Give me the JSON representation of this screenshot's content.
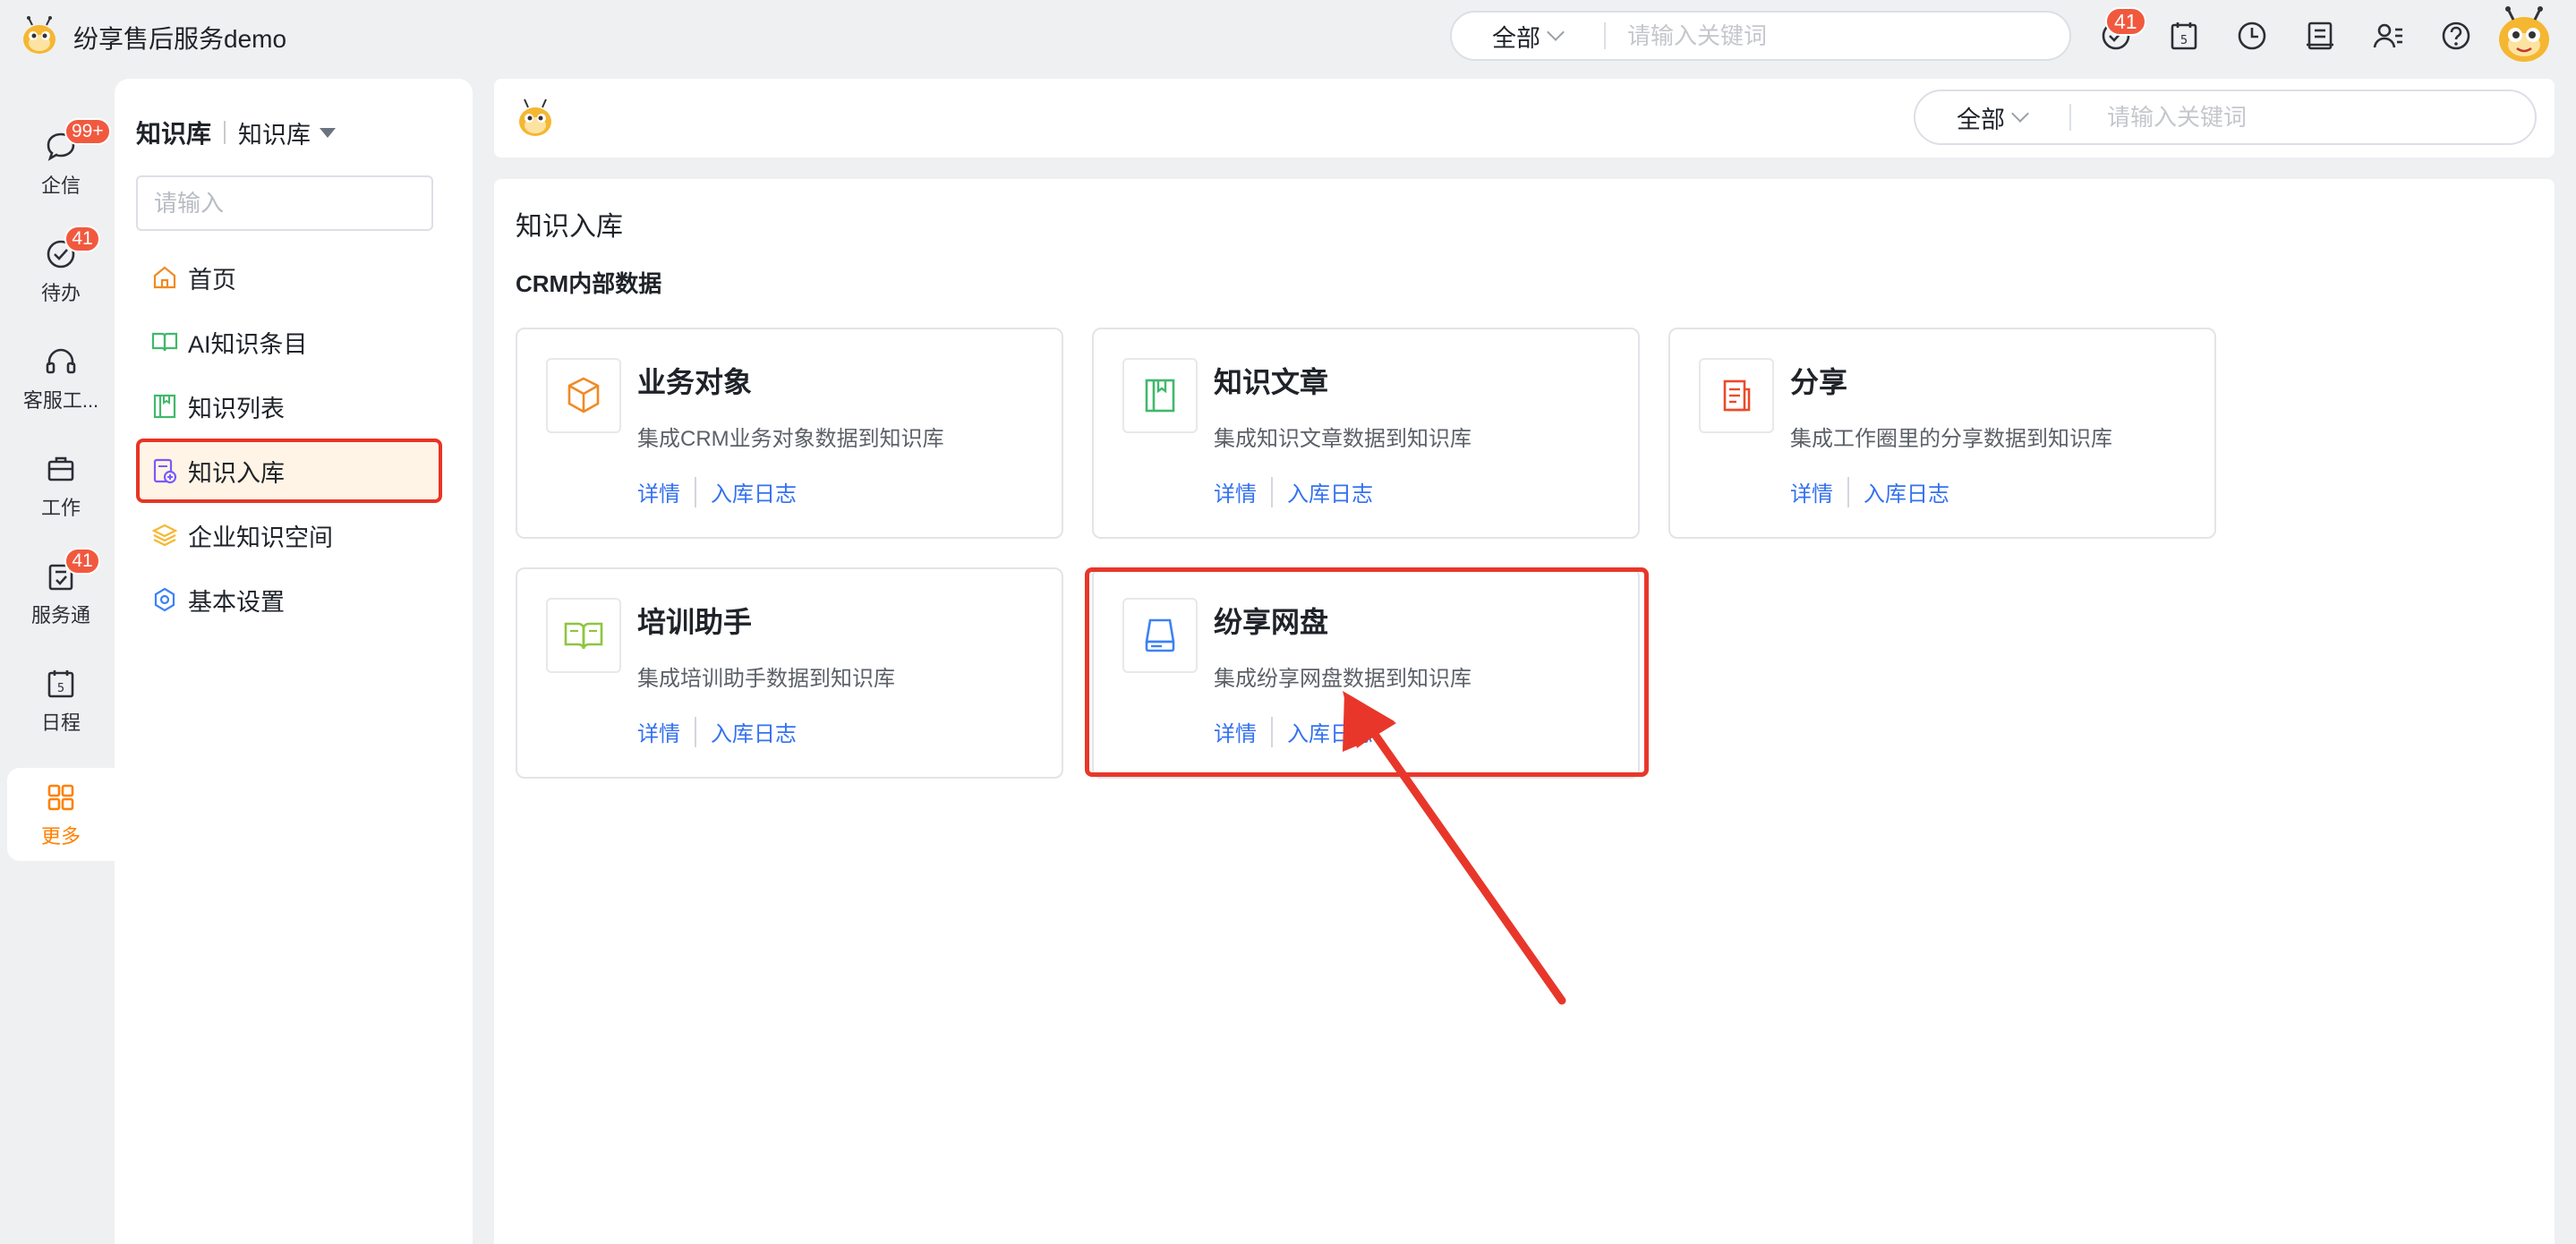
{
  "app": {
    "title": "纷享售后服务demo"
  },
  "topbar": {
    "search_scope": "全部",
    "search_placeholder": "请输入关键词",
    "notification_badge": "41",
    "icons": [
      "approval-icon",
      "calendar-icon",
      "clock-icon",
      "report-icon",
      "contacts-icon",
      "help-icon"
    ]
  },
  "rail": {
    "items": [
      {
        "label": "企信",
        "icon": "chat-icon",
        "badge": "99+"
      },
      {
        "label": "待办",
        "icon": "todo-icon",
        "badge": "41"
      },
      {
        "label": "客服工...",
        "icon": "headset-icon"
      },
      {
        "label": "工作",
        "icon": "briefcase-icon"
      },
      {
        "label": "服务通",
        "icon": "service-icon",
        "badge": "41"
      },
      {
        "label": "日程",
        "icon": "calendar-icon"
      },
      {
        "label": "更多",
        "icon": "grid-icon"
      }
    ]
  },
  "sidebar": {
    "title": "知识库",
    "subtitle": "知识库",
    "search_placeholder": "请输入",
    "menu": [
      {
        "label": "首页",
        "icon": "home-icon"
      },
      {
        "label": "AI知识条目",
        "icon": "book-icon"
      },
      {
        "label": "知识列表",
        "icon": "list-icon"
      },
      {
        "label": "知识入库",
        "icon": "import-icon",
        "active": true
      },
      {
        "label": "企业知识空间",
        "icon": "layers-icon"
      },
      {
        "label": "基本设置",
        "icon": "settings-icon"
      }
    ]
  },
  "mainhead": {
    "search_scope": "全部",
    "search_placeholder": "请输入关键词"
  },
  "content": {
    "page_title": "知识入库",
    "section_title": "CRM内部数据",
    "cards": [
      {
        "name": "业务对象",
        "desc": "集成CRM业务对象数据到知识库",
        "detail": "详情",
        "log": "入库日志",
        "icon": "cube-icon",
        "color": "#f08a24"
      },
      {
        "name": "知识文章",
        "desc": "集成知识文章数据到知识库",
        "detail": "详情",
        "log": "入库日志",
        "icon": "article-icon",
        "color": "#3fb96a"
      },
      {
        "name": "分享",
        "desc": "集成工作圈里的分享数据到知识库",
        "detail": "详情",
        "log": "入库日志",
        "icon": "share-doc-icon",
        "color": "#ea4b2b"
      },
      {
        "name": "培训助手",
        "desc": "集成培训助手数据到知识库",
        "detail": "详情",
        "log": "入库日志",
        "icon": "open-book-icon",
        "color": "#8dc63f"
      },
      {
        "name": "纷享网盘",
        "desc": "集成纷享网盘数据到知识库",
        "detail": "详情",
        "log": "入库日志",
        "icon": "drive-icon",
        "color": "#3b82f6"
      }
    ]
  },
  "colors": {
    "accent": "#ff8000",
    "link": "#3471f0",
    "badge": "#f1593f",
    "annotation": "#e8372a"
  }
}
